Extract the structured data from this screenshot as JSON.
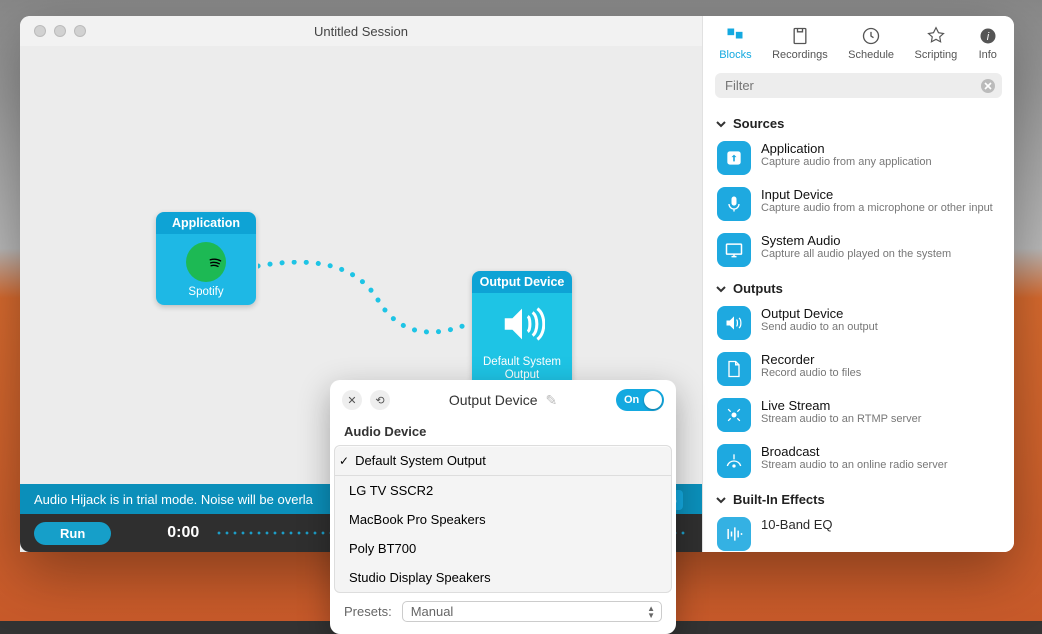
{
  "window": {
    "title": "Untitled Session"
  },
  "blocks": {
    "application": {
      "header": "Application",
      "sub": "Spotify"
    },
    "output": {
      "header": "Output Device",
      "sub": "Default System\nOutput"
    }
  },
  "trial_banner": "Audio Hijack is in trial mode. Noise will be overla",
  "footer": {
    "run": "Run",
    "time": "0:00",
    "pct": "%"
  },
  "library": {
    "tabs": {
      "blocks": "Blocks",
      "recordings": "Recordings",
      "schedule": "Schedule",
      "scripting": "Scripting",
      "info": "Info"
    },
    "filter_placeholder": "Filter",
    "sections": {
      "sources": "Sources",
      "outputs": "Outputs",
      "effects": "Built-In Effects"
    },
    "items": {
      "application": {
        "title": "Application",
        "desc": "Capture audio from any application"
      },
      "input_device": {
        "title": "Input Device",
        "desc": "Capture audio from a microphone or other input"
      },
      "system_audio": {
        "title": "System Audio",
        "desc": "Capture all audio played on the system"
      },
      "output_device": {
        "title": "Output Device",
        "desc": "Send audio to an output"
      },
      "recorder": {
        "title": "Recorder",
        "desc": "Record audio to files"
      },
      "live_stream": {
        "title": "Live Stream",
        "desc": "Stream audio to an RTMP server"
      },
      "broadcast": {
        "title": "Broadcast",
        "desc": "Stream audio to an online radio server"
      },
      "ten_band_eq": {
        "title": "10-Band EQ",
        "desc": ""
      }
    }
  },
  "popover": {
    "title": "Output Device",
    "toggle": "On",
    "section": "Audio Device",
    "options": {
      "default": "Default System Output",
      "lg": "LG TV SSCR2",
      "mbp": "MacBook Pro Speakers",
      "poly": "Poly BT700",
      "studio": "Studio Display Speakers"
    },
    "presets_label": "Presets:",
    "presets_value": "Manual"
  }
}
